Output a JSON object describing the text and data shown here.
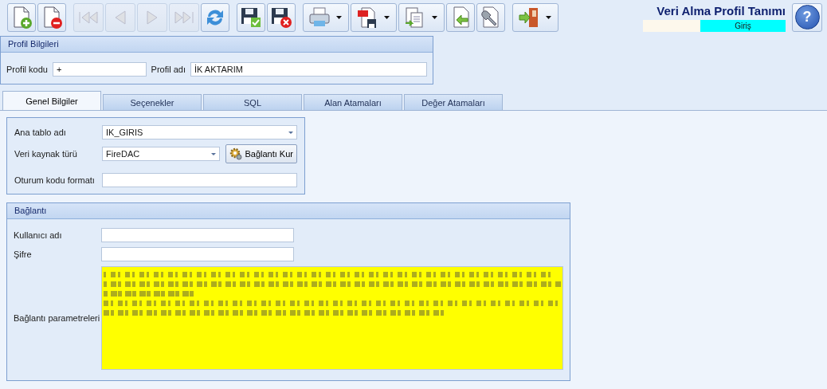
{
  "toolbar": {
    "buttons": [
      {
        "kind": "new",
        "disabled": false,
        "dropdown": false
      },
      {
        "kind": "delete",
        "disabled": false,
        "dropdown": false
      },
      {
        "kind": "first",
        "disabled": true,
        "dropdown": false
      },
      {
        "kind": "prev",
        "disabled": true,
        "dropdown": false
      },
      {
        "kind": "next",
        "disabled": true,
        "dropdown": false
      },
      {
        "kind": "last",
        "disabled": true,
        "dropdown": false
      },
      {
        "kind": "refresh",
        "disabled": false,
        "dropdown": false
      },
      {
        "kind": "save",
        "disabled": false,
        "dropdown": false
      },
      {
        "kind": "cancel",
        "disabled": false,
        "dropdown": false
      },
      {
        "kind": "print",
        "disabled": false,
        "dropdown": true
      },
      {
        "kind": "pdf",
        "disabled": false,
        "dropdown": true
      },
      {
        "kind": "copy",
        "disabled": false,
        "dropdown": true
      },
      {
        "kind": "import",
        "disabled": false,
        "dropdown": false
      },
      {
        "kind": "tools",
        "disabled": false,
        "dropdown": false
      },
      {
        "kind": "exit",
        "disabled": false,
        "dropdown": true
      }
    ]
  },
  "window": {
    "title": "Veri Alma Profil Tanımı",
    "mode": "Giriş",
    "help": "?"
  },
  "profile_panel": {
    "title": "Profil Bilgileri",
    "fields": [
      {
        "label": "Profil kodu",
        "value": "+"
      },
      {
        "label": "Profil adı",
        "value": "İK AKTARIM"
      }
    ]
  },
  "tabs": [
    {
      "label": "Genel Bilgiler",
      "selected": true
    },
    {
      "label": "Seçenekler",
      "selected": false
    },
    {
      "label": "SQL",
      "selected": false
    },
    {
      "label": "Alan Atamaları",
      "selected": false
    },
    {
      "label": "Değer Atamaları",
      "selected": false
    }
  ],
  "general_panel": {
    "fields": [
      {
        "kind": "combo",
        "label": "Ana tablo adı",
        "value": "IK_GIRIS"
      },
      {
        "kind": "combo",
        "label": "Veri kaynak türü",
        "value": "FireDAC",
        "button": "Bağlantı Kur"
      },
      {
        "kind": "text",
        "label": "Oturum kodu formatı"
      }
    ]
  },
  "connection_panel": {
    "title": "Bağlantı",
    "fields": [
      {
        "kind": "text",
        "label": "Kullanıcı adı"
      },
      {
        "kind": "text",
        "label": "Şifre"
      },
      {
        "kind": "memo",
        "label": "Bağlantı parametreleri",
        "highlighted": true
      }
    ]
  }
}
